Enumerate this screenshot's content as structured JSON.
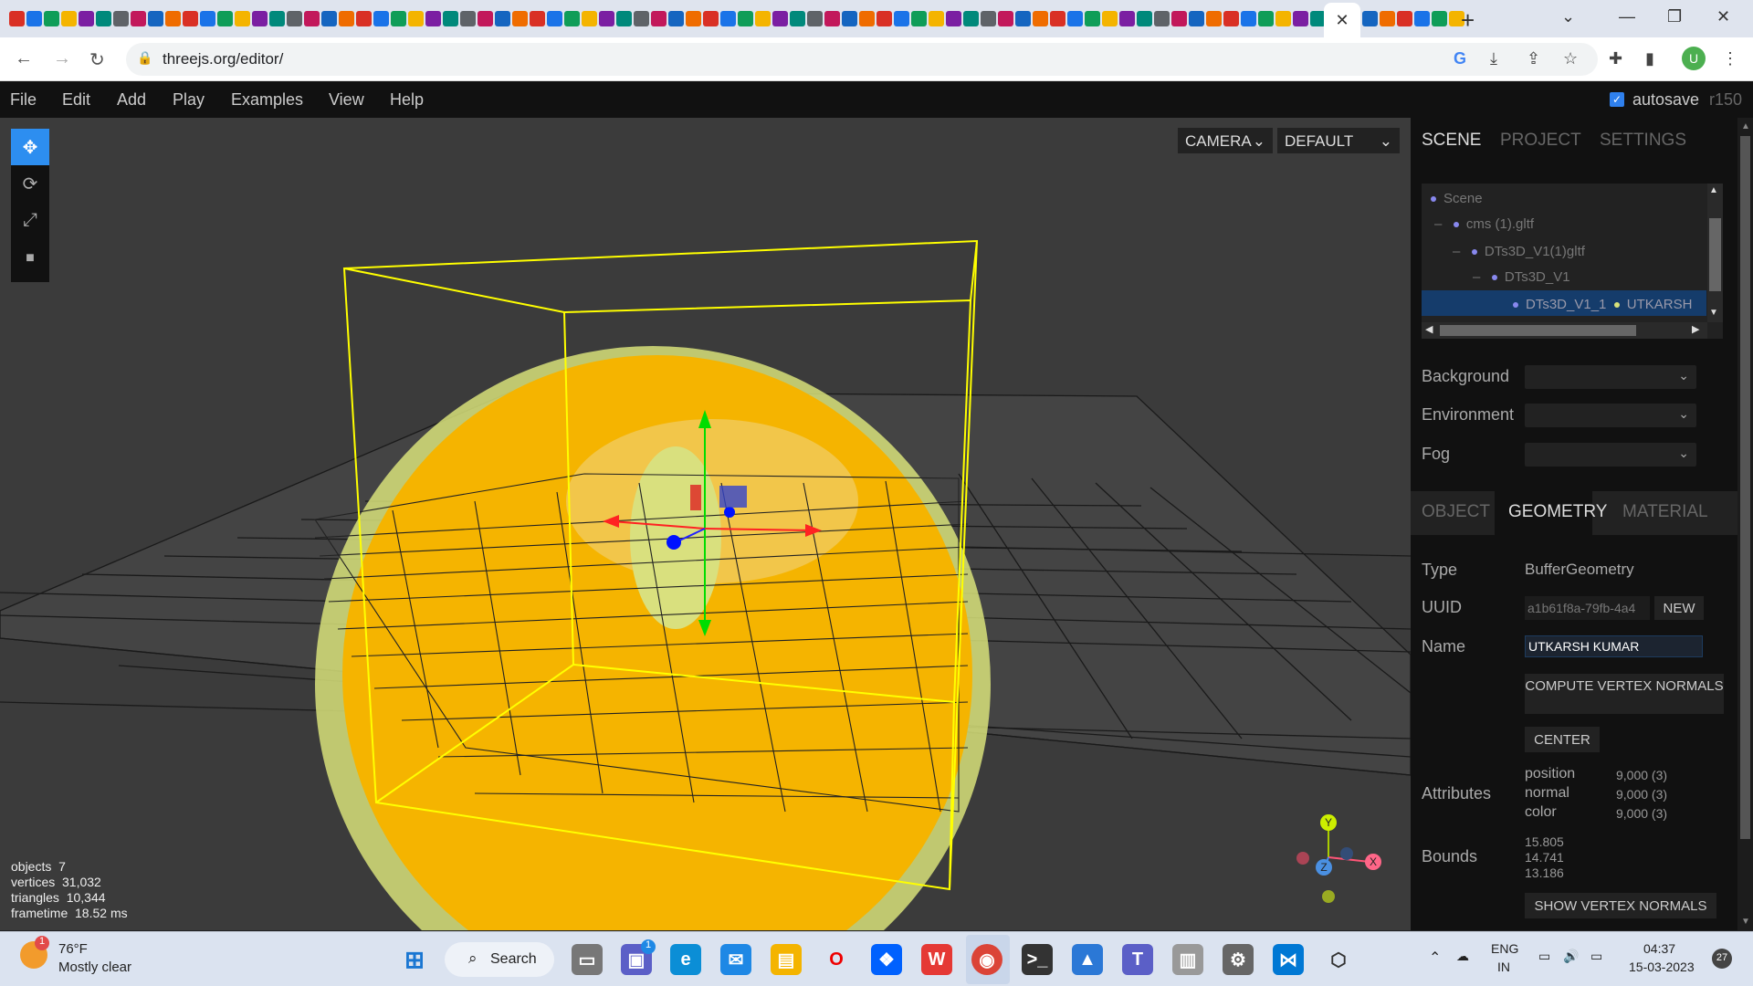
{
  "browser": {
    "url": "threejs.org/editor/",
    "profile_initial": "U",
    "new_tab_glyph": "+",
    "close_tab_glyph": "✕"
  },
  "menu": {
    "items": [
      "File",
      "Edit",
      "Add",
      "Play",
      "Examples",
      "View",
      "Help"
    ],
    "autosave_label": "autosave",
    "revision": "r150"
  },
  "viewport": {
    "camera_select": "CAMERA",
    "shading_select": "DEFAULT",
    "stats": {
      "objects_label": "objects",
      "objects": "7",
      "vertices_label": "vertices",
      "vertices": "31,032",
      "triangles_label": "triangles",
      "triangles": "10,344",
      "frametime_label": "frametime",
      "frametime": "18.52 ms"
    },
    "view_helper": {
      "y": "Y",
      "z": "Z",
      "x": "X"
    },
    "colors": {
      "mesh": "#f5b400",
      "mesh_edge": "#d8e27a",
      "bbox": "#ffff00",
      "grid": "#111111",
      "background": "#3b3b3b"
    }
  },
  "sidebar": {
    "tabs": [
      "SCENE",
      "PROJECT",
      "SETTINGS"
    ],
    "outliner": [
      {
        "label": "Scene"
      },
      {
        "label": "cms (1).gltf"
      },
      {
        "label": "DTs3D_V1(1)gltf"
      },
      {
        "label": "DTs3D_V1"
      },
      {
        "label": "DTs3D_V1_1",
        "material": "UTKARSH"
      }
    ],
    "scene_props": {
      "background_label": "Background",
      "environment_label": "Environment",
      "fog_label": "Fog"
    },
    "prop_tabs": [
      "OBJECT",
      "GEOMETRY",
      "MATERIAL"
    ],
    "geometry": {
      "type_label": "Type",
      "type": "BufferGeometry",
      "uuid_label": "UUID",
      "uuid": "a1b61f8a-79fb-4a4",
      "new_button": "NEW",
      "name_label": "Name",
      "name": "UTKARSH KUMAR",
      "compute_normals_button": "COMPUTE VERTEX NORMALS",
      "center_button": "CENTER",
      "attributes_label": "Attributes",
      "attributes": [
        {
          "name": "position",
          "value": "9,000 (3)"
        },
        {
          "name": "normal",
          "value": "9,000 (3)"
        },
        {
          "name": "color",
          "value": "9,000 (3)"
        }
      ],
      "bounds_label": "Bounds",
      "bounds": [
        "15.805",
        "14.741",
        "13.186"
      ],
      "show_normals_button": "SHOW VERTEX NORMALS"
    }
  },
  "taskbar": {
    "weather_temp": "76°F",
    "weather_text": "Mostly clear",
    "search_label": "Search",
    "lang": "ENG",
    "region": "IN",
    "time": "04:37",
    "date": "15-03-2023",
    "notification_count": "27",
    "teams_badge": "1",
    "weather_badge": "1"
  }
}
